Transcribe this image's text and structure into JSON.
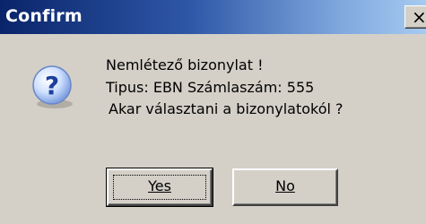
{
  "window": {
    "title": "Confirm",
    "close_glyph": "×"
  },
  "icon": {
    "name": "question-icon",
    "glyph": "?"
  },
  "message": {
    "line1": "Nemlétező bizonylat !",
    "line2": "Tipus: EBN Számlaszám: 555",
    "line3": "Akar választani a bizonylatokól ?"
  },
  "buttons": {
    "yes_label": "Yes",
    "no_label": "No"
  },
  "colors": {
    "titlebar_start": "#0a246a",
    "titlebar_end": "#a6caf0",
    "dialog_face": "#d4d0c8"
  }
}
